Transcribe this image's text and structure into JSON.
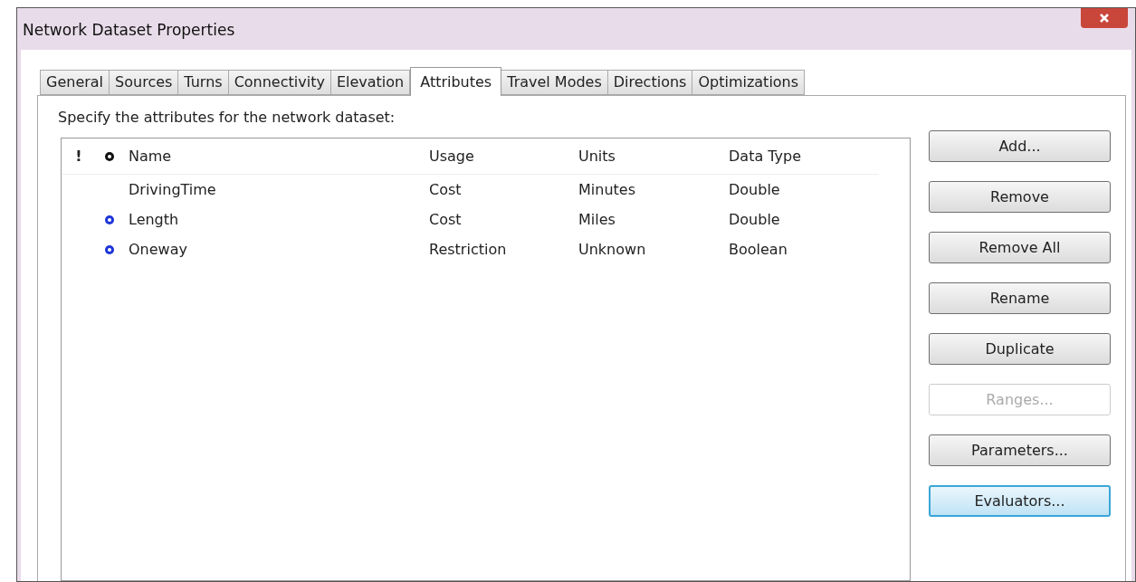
{
  "window": {
    "title": "Network Dataset Properties"
  },
  "tabs": [
    {
      "label": "General",
      "selected": false
    },
    {
      "label": "Sources",
      "selected": false
    },
    {
      "label": "Turns",
      "selected": false
    },
    {
      "label": "Connectivity",
      "selected": false
    },
    {
      "label": "Elevation",
      "selected": false
    },
    {
      "label": "Attributes",
      "selected": true
    },
    {
      "label": "Travel Modes",
      "selected": false
    },
    {
      "label": "Directions",
      "selected": false
    },
    {
      "label": "Optimizations",
      "selected": false
    }
  ],
  "instruction": "Specify the attributes for the network dataset:",
  "table": {
    "columns": [
      "!",
      "Name",
      "Usage",
      "Units",
      "Data Type"
    ],
    "rows": [
      {
        "default": false,
        "name": "DrivingTime",
        "usage": "Cost",
        "units": "Minutes",
        "data_type": "Double"
      },
      {
        "default": true,
        "name": "Length",
        "usage": "Cost",
        "units": "Miles",
        "data_type": "Double"
      },
      {
        "default": true,
        "name": "Oneway",
        "usage": "Restriction",
        "units": "Unknown",
        "data_type": "Boolean"
      }
    ]
  },
  "buttons": [
    {
      "label": "Add...",
      "disabled": false,
      "focused": false
    },
    {
      "label": "Remove",
      "disabled": false,
      "focused": false
    },
    {
      "label": "Remove All",
      "disabled": false,
      "focused": false
    },
    {
      "label": "Rename",
      "disabled": false,
      "focused": false
    },
    {
      "label": "Duplicate",
      "disabled": false,
      "focused": false
    },
    {
      "label": "Ranges...",
      "disabled": true,
      "focused": false
    },
    {
      "label": "Parameters...",
      "disabled": false,
      "focused": false
    },
    {
      "label": "Evaluators...",
      "disabled": false,
      "focused": true
    }
  ]
}
